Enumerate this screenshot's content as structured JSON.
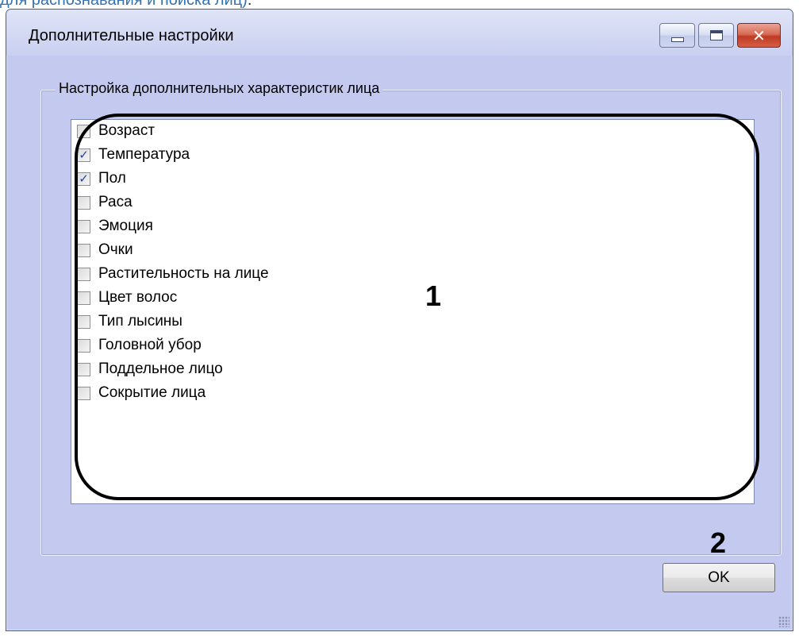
{
  "page": {
    "link_text": "для распознавания и поиска лиц)",
    "link_tail": "."
  },
  "window": {
    "title": "Дополнительные настройки",
    "buttons": {
      "minimize_icon": "minimize-icon",
      "maximize_icon": "maximize-icon",
      "close_icon": "close-icon"
    }
  },
  "group": {
    "legend": "Настройка дополнительных характеристик лица",
    "items": [
      {
        "label": "Возраст",
        "checked": false
      },
      {
        "label": "Температура",
        "checked": true
      },
      {
        "label": "Пол",
        "checked": true
      },
      {
        "label": "Раса",
        "checked": false
      },
      {
        "label": "Эмоция",
        "checked": false
      },
      {
        "label": "Очки",
        "checked": false
      },
      {
        "label": "Растительность на лице",
        "checked": false
      },
      {
        "label": "Цвет волос",
        "checked": false
      },
      {
        "label": "Тип лысины",
        "checked": false
      },
      {
        "label": "Головной убор",
        "checked": false
      },
      {
        "label": "Поддельное лицо",
        "checked": false
      },
      {
        "label": "Сокрытие лица",
        "checked": false
      }
    ]
  },
  "callouts": {
    "first": "1",
    "second": "2"
  },
  "ok_button": {
    "label": "OK"
  },
  "colors": {
    "window_bg": "#c4caef",
    "link": "#3572b0",
    "check_mark": "#21469f",
    "close_button": "#c03a22"
  }
}
